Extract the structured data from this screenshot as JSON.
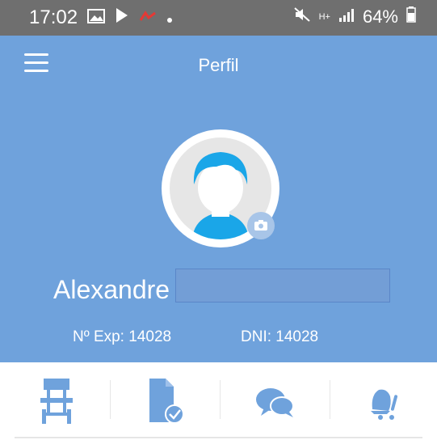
{
  "status_bar": {
    "time": "17:02",
    "battery_percent": "64%",
    "network_label": "H+"
  },
  "header": {
    "title": "Perfil"
  },
  "profile": {
    "first_name": "Alexandre",
    "exp_label": "Nº Exp: 14028",
    "dni_label": "DNI: 14028"
  },
  "actions": [
    {
      "icon": "desk-chair-icon"
    },
    {
      "icon": "document-check-icon"
    },
    {
      "icon": "chat-bubbles-icon"
    },
    {
      "icon": "alert-bell-icon"
    }
  ],
  "colors": {
    "header_bg": "#6fa2dc",
    "status_bg": "#6f6f6f",
    "icon_blue": "#6fa2dc",
    "avatar_hair": "#1aa6e8"
  }
}
